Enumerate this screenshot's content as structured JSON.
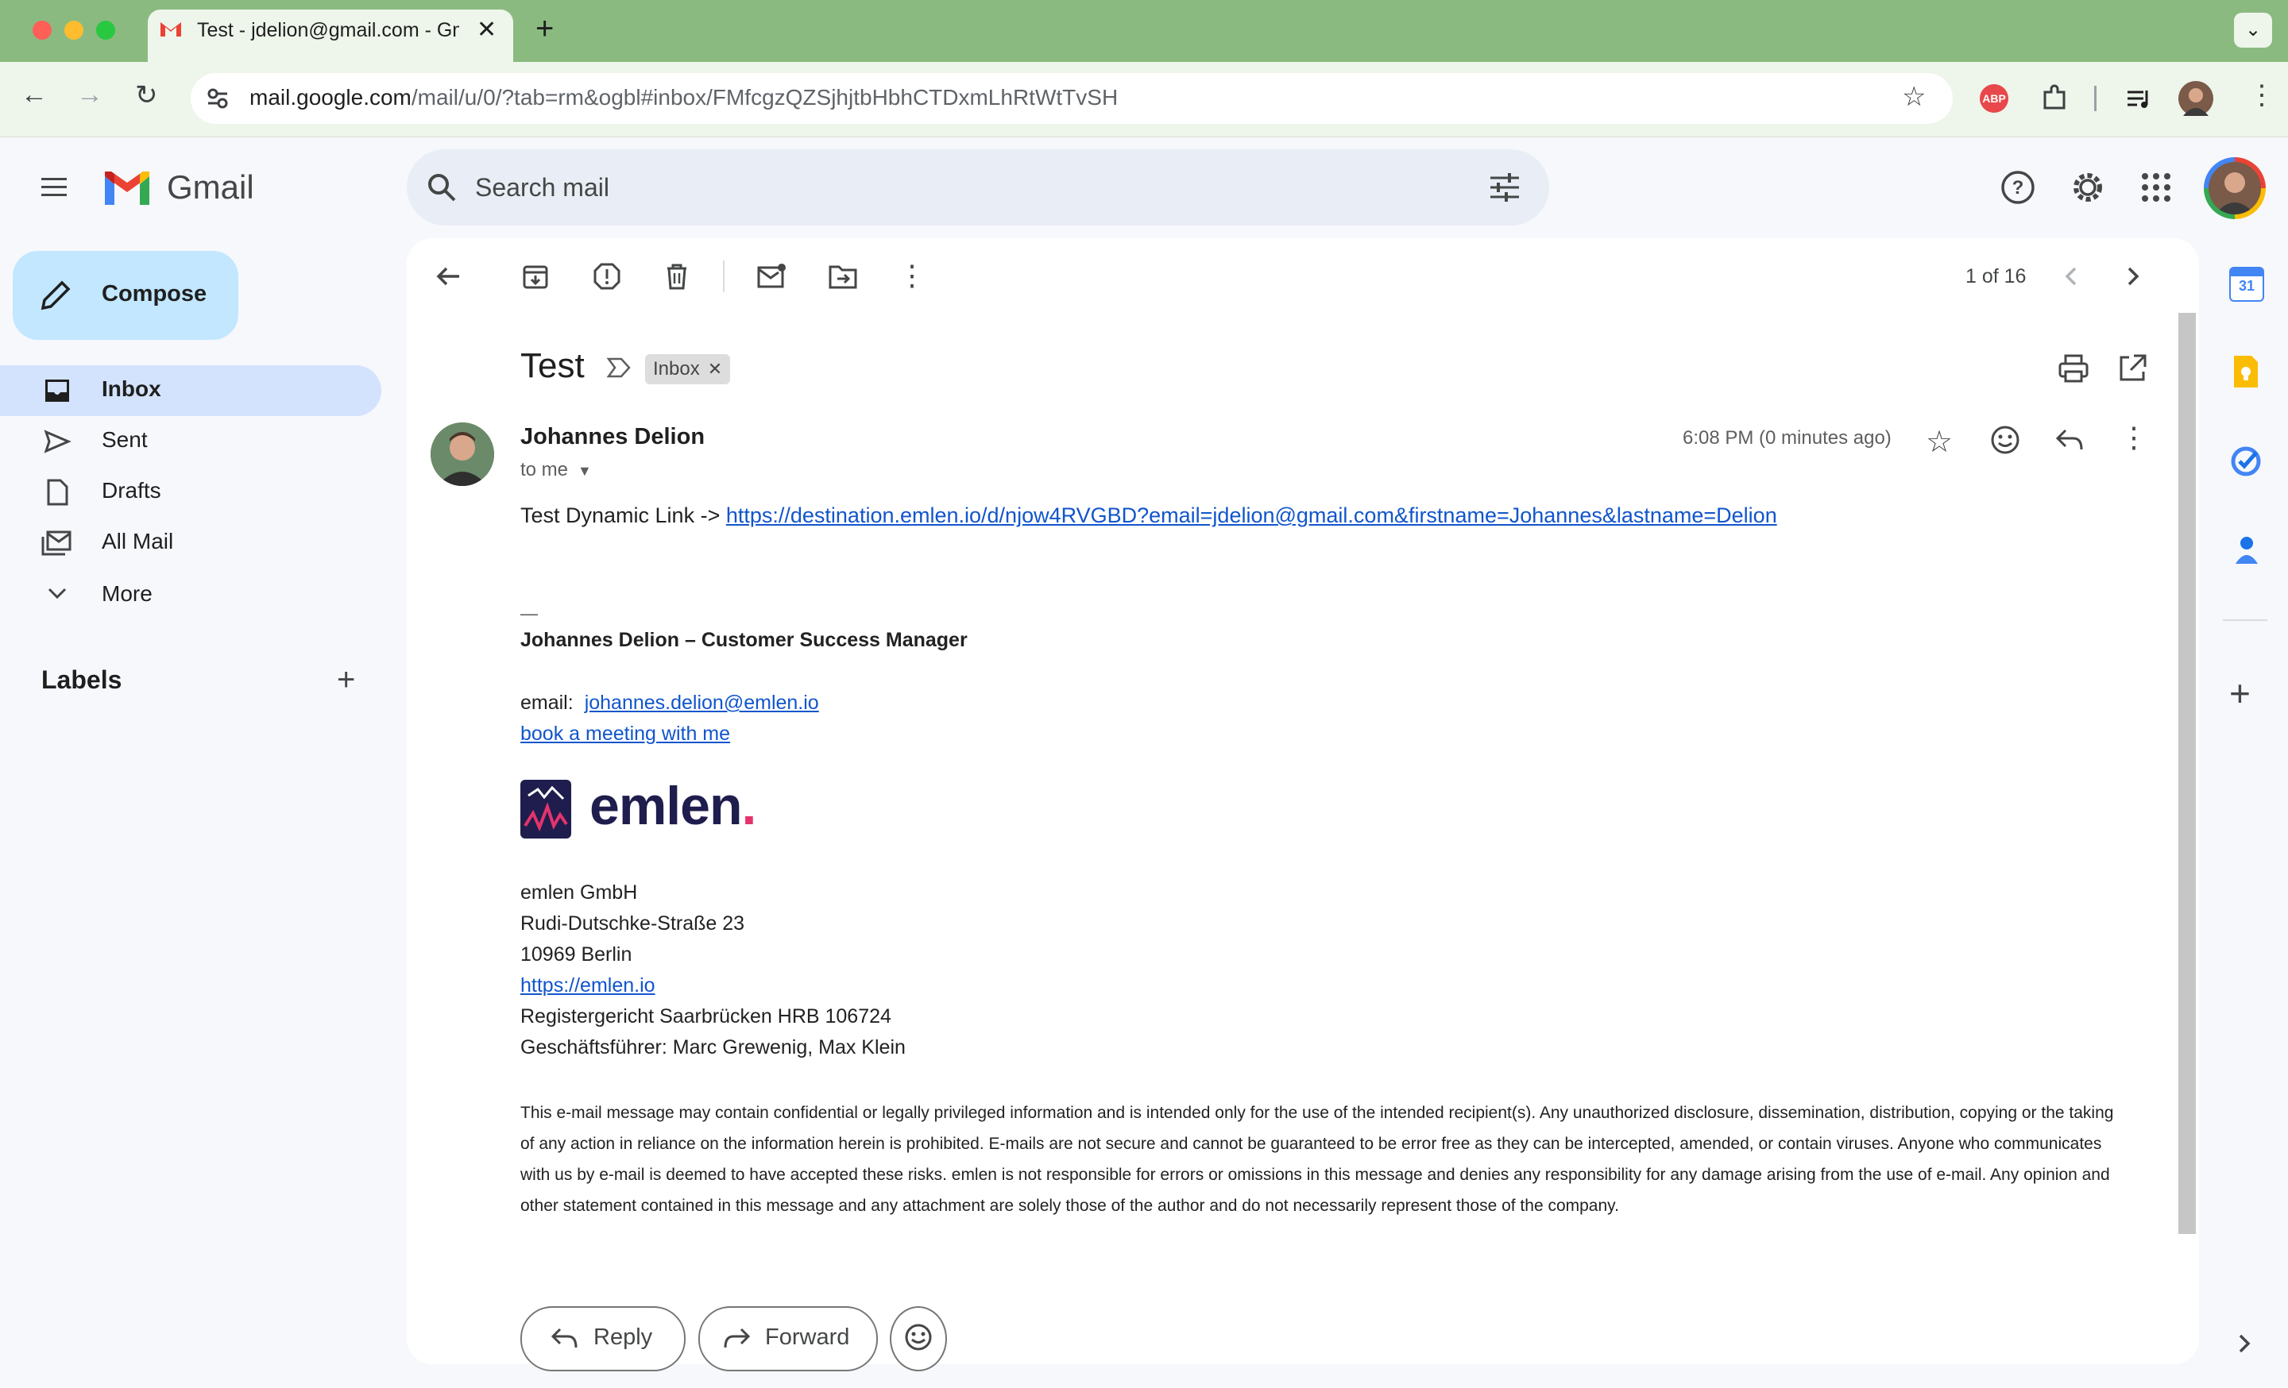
{
  "browser": {
    "tab_title": "Test - jdelion@gmail.com - Gmail",
    "new_tab": "+",
    "url_host": "mail.google.com",
    "url_path": "/mail/u/0/?tab=rm&ogbl#inbox/FMfcgzQZSjhjtbHbhCTDxmLhRtWtTvSH",
    "abp_label": "ABP"
  },
  "gmail": {
    "product_name": "Gmail",
    "search_placeholder": "Search mail",
    "compose_label": "Compose",
    "nav": [
      {
        "label": "Inbox"
      },
      {
        "label": "Sent"
      },
      {
        "label": "Drafts"
      },
      {
        "label": "All Mail"
      },
      {
        "label": "More"
      }
    ],
    "labels_heading": "Labels"
  },
  "toolbar": {
    "pagination": "1 of 16"
  },
  "message": {
    "subject": "Test",
    "label_chip": "Inbox",
    "sender": "Johannes Delion",
    "recipient": "to me",
    "time": "6:08 PM (0 minutes ago)",
    "body_prefix": "Test Dynamic Link -> ",
    "body_link": "https://destination.emlen.io/d/njow4RVGBD?email=jdelion@gmail.com&firstname=Johannes&lastname=Delion",
    "sig_dash": "—",
    "sig_name": "Johannes Delion – Customer Success Manager",
    "email_label": "email:",
    "email_link": "johannes.delion@emlen.io",
    "meeting_link": "book a meeting with me",
    "logo_text": "emlen",
    "company": "emlen GmbH",
    "street": "Rudi-Dutschke-Straße 23",
    "city": "10969 Berlin",
    "website": "https://emlen.io",
    "register": "Registergericht Saarbrücken HRB 106724",
    "ceo": "Geschäftsführer: Marc Grewenig, Max Klein",
    "disclaimer": "This e-mail message may contain confidential or legally privileged information and is intended only for the use of the intended recipient(s). Any unauthorized disclosure, dissemination, distribution, copying or the taking of any action in reliance on the information herein is prohibited. E-mails are not secure and cannot be guaranteed to be error free as they can be intercepted, amended, or contain viruses. Anyone who communicates with us by e-mail is deemed to have accepted these risks. emlen is not responsible for errors or omissions in this message and denies any responsibility for any damage arising from the use of e-mail. Any opinion and other statement contained in this message and any attachment are solely those of the author and do not necessarily represent those of the company."
  },
  "actions": {
    "reply": "Reply",
    "forward": "Forward"
  },
  "sidepanel": {
    "calendar_day": "31"
  },
  "colors": {
    "titlebar": "#8bba81",
    "compose_bg": "#c2e7ff",
    "inbox_active_bg": "#d3e3fd",
    "link": "#1155cc",
    "gmail_red": "#ea4335"
  }
}
